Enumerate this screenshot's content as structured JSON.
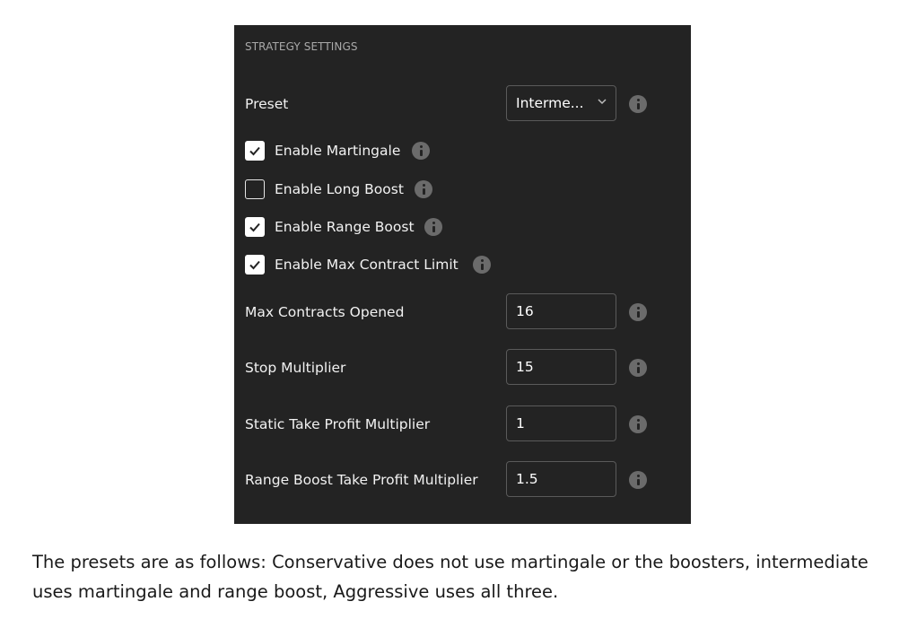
{
  "panel": {
    "section_title": "STRATEGY SETTINGS",
    "preset": {
      "label": "Preset",
      "selected": "Interme..."
    },
    "checkboxes": [
      {
        "label": "Enable Martingale",
        "checked": true
      },
      {
        "label": "Enable Long Boost",
        "checked": false
      },
      {
        "label": "Enable Range Boost",
        "checked": true
      },
      {
        "label": "Enable Max Contract Limit",
        "checked": true
      }
    ],
    "fields": [
      {
        "label": "Max Contracts Opened",
        "value": "16"
      },
      {
        "label": "Stop Multiplier",
        "value": "15"
      },
      {
        "label": "Static Take Profit Multiplier",
        "value": "1"
      },
      {
        "label": "Range Boost Take Profit Multiplier",
        "value": "1.5"
      }
    ]
  },
  "caption": "The presets are as follows: Conservative does not use martingale or the boosters, intermediate uses martingale and range boost, Aggressive uses all three.",
  "icons": {
    "info": "info-icon",
    "check": "checkmark-icon",
    "dropdown": "chevron-down-icon"
  },
  "colors": {
    "panel_background": "#232323",
    "input_border": "#5a5a5a",
    "info_icon": "#6b6b6b",
    "section_title": "#a9a9a9"
  }
}
